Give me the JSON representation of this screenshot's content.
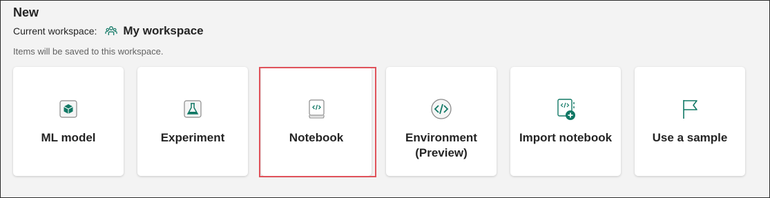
{
  "header": {
    "title": "New",
    "workspace_label": "Current workspace:",
    "workspace_name": "My workspace",
    "workspace_icon": "people-icon",
    "hint": "Items will be saved to this workspace."
  },
  "cards": [
    {
      "label": "ML model",
      "icon": "cube-icon"
    },
    {
      "label": "Experiment",
      "icon": "flask-icon"
    },
    {
      "label": "Notebook",
      "icon": "notebook-icon",
      "highlighted": true
    },
    {
      "label_line1": "Environment",
      "label_line2": "(Preview)",
      "icon": "code-circle-icon"
    },
    {
      "label": "Import notebook",
      "icon": "import-notebook-icon"
    },
    {
      "label": "Use a sample",
      "icon": "flag-icon"
    }
  ],
  "colors": {
    "accent": "#117865",
    "highlight_border": "#e0525a",
    "background": "#f3f3f3"
  }
}
